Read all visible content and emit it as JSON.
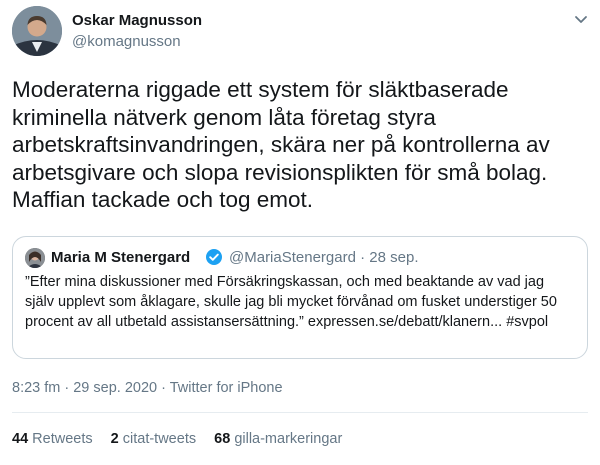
{
  "author": {
    "name": "Oskar Magnusson",
    "handle": "@komagnusson"
  },
  "tweet": {
    "text": "Moderaterna riggade ett system för släktbaserade\nkriminella nätverk genom låta företag styra\narbetskraftsinvandringen, skära ner på kontrollerna av\narbetsgivare och slopa revisionsplikten för små bolag.\nMaffian tackade och tog emot."
  },
  "quoted": {
    "name": "Maria M Stenergard",
    "handle": "@MariaStenergard",
    "dot": "·",
    "date": "28 sep.",
    "text": "”Efter mina diskussioner med Försäkringskassan, och med beaktande av vad jag själv upplevt som åklagare, skulle jag bli mycket förvånad om fusket understiger 50 procent av all utbetald assistansersättning.” expressen.se/debatt/klanern... #svpol"
  },
  "meta": {
    "timestamp": "8:23 fm · 29 sep. 2020 · Twitter for iPhone"
  },
  "stats": {
    "retweets_count": "44",
    "retweets_label": "Retweets",
    "quotes_count": "2",
    "quotes_label": "citat-tweets",
    "likes_count": "68",
    "likes_label": "gilla-markeringar"
  },
  "icons": {
    "caret": "chevron-down-icon",
    "verified": "verified-badge-icon"
  },
  "colors": {
    "text": "#14171a",
    "secondary": "#657786",
    "verified": "#1da1f2",
    "border": "#ccd6dd"
  }
}
